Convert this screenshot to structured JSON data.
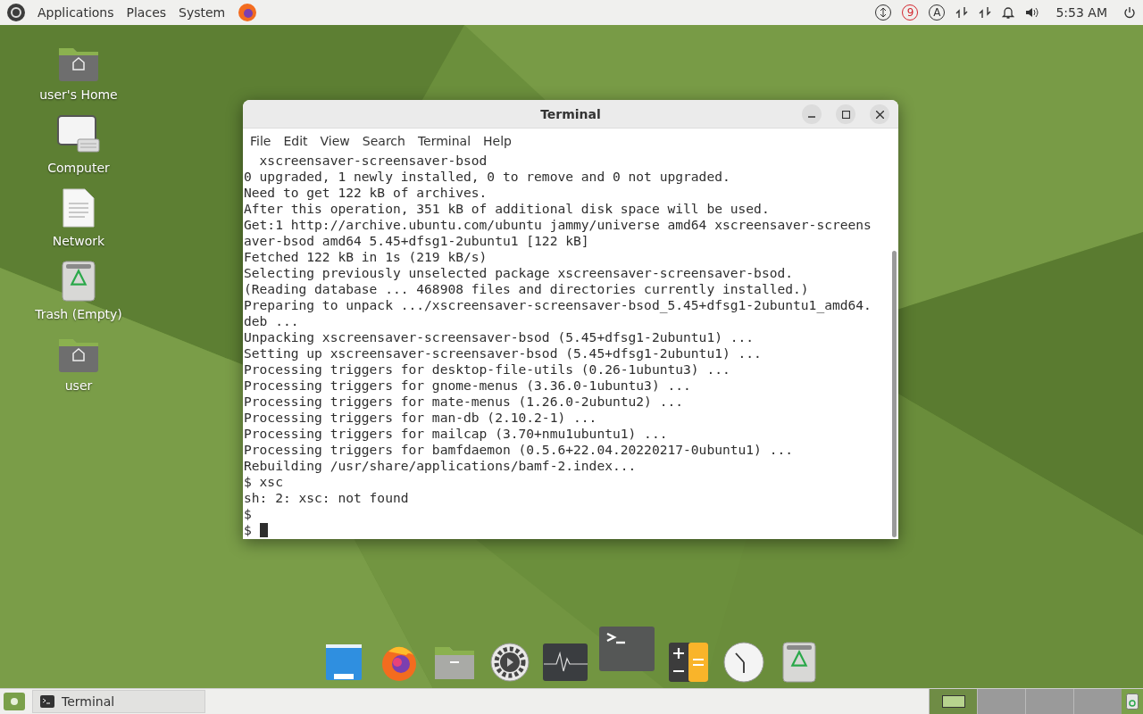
{
  "top_panel": {
    "menus": [
      "Applications",
      "Places",
      "System"
    ],
    "indicators": [
      {
        "kind": "updates"
      },
      {
        "kind": "count",
        "text": "9"
      },
      {
        "kind": "letter",
        "text": "A"
      },
      {
        "kind": "network"
      },
      {
        "kind": "network"
      },
      {
        "kind": "bell"
      },
      {
        "kind": "volume"
      }
    ],
    "clock": "5:53 AM"
  },
  "desktop_icons": [
    {
      "kind": "home",
      "label": "user's Home"
    },
    {
      "kind": "computer",
      "label": "Computer"
    },
    {
      "kind": "document",
      "label": "Network"
    },
    {
      "kind": "trash",
      "label": "Trash (Empty)"
    },
    {
      "kind": "home",
      "label": "user"
    }
  ],
  "terminal": {
    "title": "Terminal",
    "menu": [
      "File",
      "Edit",
      "View",
      "Search",
      "Terminal",
      "Help"
    ],
    "lines": [
      "  xscreensaver-screensaver-bsod",
      "0 upgraded, 1 newly installed, 0 to remove and 0 not upgraded.",
      "Need to get 122 kB of archives.",
      "After this operation, 351 kB of additional disk space will be used.",
      "Get:1 http://archive.ubuntu.com/ubuntu jammy/universe amd64 xscreensaver-screens",
      "aver-bsod amd64 5.45+dfsg1-2ubuntu1 [122 kB]",
      "Fetched 122 kB in 1s (219 kB/s)",
      "Selecting previously unselected package xscreensaver-screensaver-bsod.",
      "(Reading database ... 468908 files and directories currently installed.)",
      "Preparing to unpack .../xscreensaver-screensaver-bsod_5.45+dfsg1-2ubuntu1_amd64.",
      "deb ...",
      "Unpacking xscreensaver-screensaver-bsod (5.45+dfsg1-2ubuntu1) ...",
      "Setting up xscreensaver-screensaver-bsod (5.45+dfsg1-2ubuntu1) ...",
      "Processing triggers for desktop-file-utils (0.26-1ubuntu3) ...",
      "Processing triggers for gnome-menus (3.36.0-1ubuntu3) ...",
      "Processing triggers for mate-menus (1.26.0-2ubuntu2) ...",
      "Processing triggers for man-db (2.10.2-1) ...",
      "Processing triggers for mailcap (3.70+nmu1ubuntu1) ...",
      "Processing triggers for bamfdaemon (0.5.6+22.04.20220217-0ubuntu1) ...",
      "Rebuilding /usr/share/applications/bamf-2.index...",
      "$ xsc",
      "sh: 2: xsc: not found",
      "$"
    ],
    "prompt": "$"
  },
  "dock": [
    {
      "kind": "desktop",
      "selected": false
    },
    {
      "kind": "browser",
      "selected": false
    },
    {
      "kind": "files",
      "selected": false
    },
    {
      "kind": "settings",
      "selected": false
    },
    {
      "kind": "monitor",
      "selected": false
    },
    {
      "kind": "terminal",
      "selected": true
    },
    {
      "kind": "calculator",
      "selected": false
    },
    {
      "kind": "clock",
      "selected": false
    },
    {
      "kind": "trash",
      "selected": false
    }
  ],
  "taskbar": {
    "buttons": [
      {
        "label": "Terminal",
        "selected": true
      }
    ],
    "workspaces": [
      {
        "selected": true
      },
      {
        "selected": false
      },
      {
        "selected": false
      },
      {
        "selected": false
      }
    ]
  }
}
